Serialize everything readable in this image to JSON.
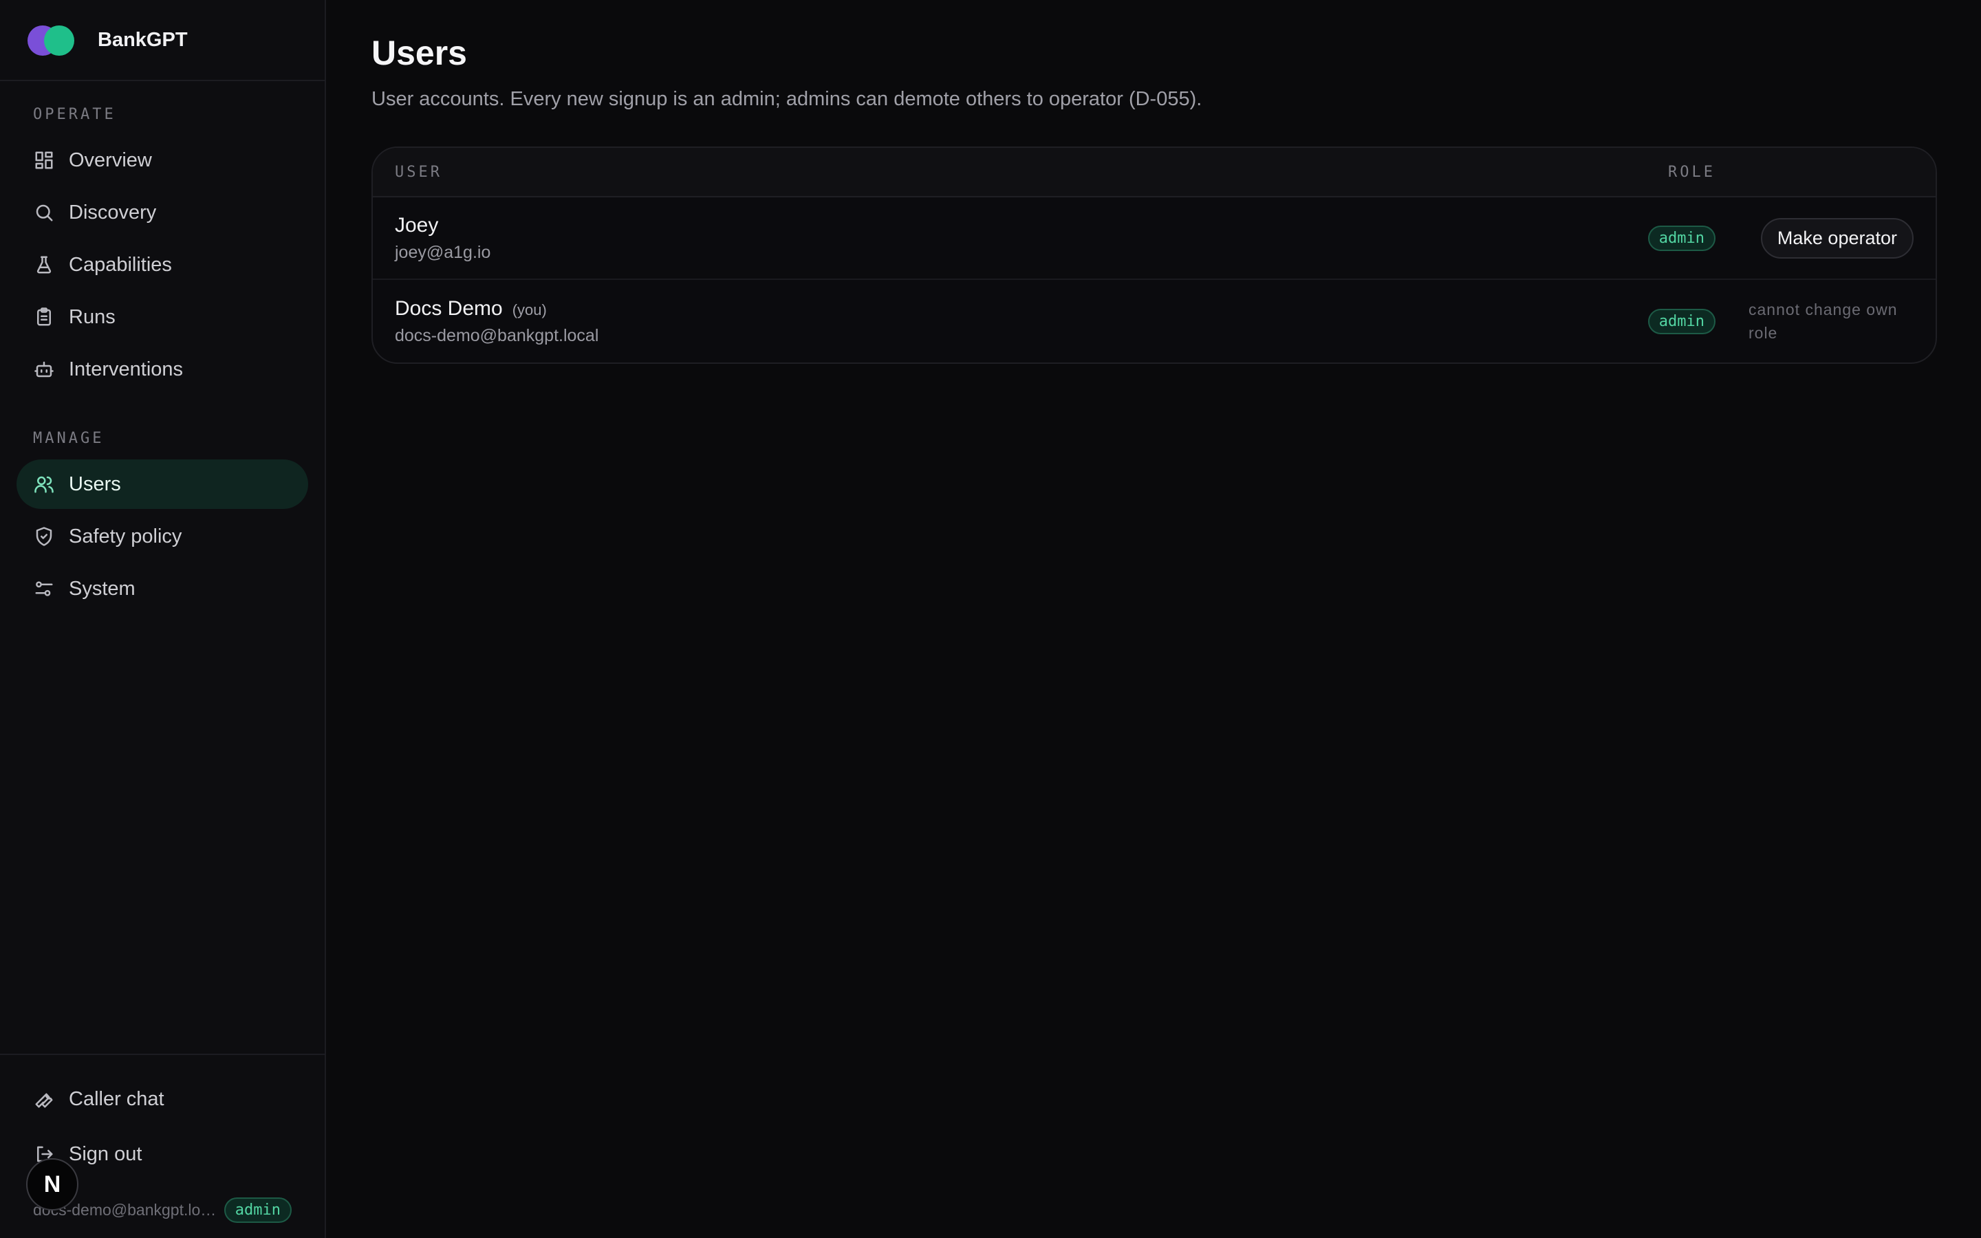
{
  "brand": {
    "name": "BankGPT"
  },
  "colors": {
    "accent": "#1fbf8a",
    "logo_primary": "#7a4fd8",
    "logo_secondary": "#1fbf8a",
    "badge_text": "#53d6a3"
  },
  "sidebar": {
    "operate_label": "OPERATE",
    "manage_label": "MANAGE",
    "operate_items": [
      {
        "label": "Overview",
        "icon": "grid-icon"
      },
      {
        "label": "Discovery",
        "icon": "search-icon"
      },
      {
        "label": "Capabilities",
        "icon": "flask-icon"
      },
      {
        "label": "Runs",
        "icon": "clipboard-icon"
      },
      {
        "label": "Interventions",
        "icon": "robot-icon"
      }
    ],
    "manage_items": [
      {
        "label": "Users",
        "icon": "users-icon",
        "active": true
      },
      {
        "label": "Safety policy",
        "icon": "shield-icon"
      },
      {
        "label": "System",
        "icon": "sliders-icon"
      }
    ],
    "bottom_items": [
      {
        "label": "Caller chat",
        "icon": "wrench-icon"
      },
      {
        "label": "Sign out",
        "icon": "sign-out-icon"
      }
    ],
    "current_user_email": "docs-demo@bankgpt.local",
    "current_user_role": "admin",
    "avatar_letter": "N"
  },
  "main": {
    "title": "Users",
    "description": "User accounts. Every new signup is an admin; admins can demote others to operator (D-055).",
    "table": {
      "col_user": "USER",
      "col_role": "ROLE",
      "rows": [
        {
          "name": "Joey",
          "email": "joey@a1g.io",
          "role": "admin",
          "action": "Make operator"
        },
        {
          "name": "Docs Demo",
          "you_tag": "(you)",
          "email": "docs-demo@bankgpt.local",
          "role": "admin",
          "note": "cannot change own role"
        }
      ]
    }
  }
}
